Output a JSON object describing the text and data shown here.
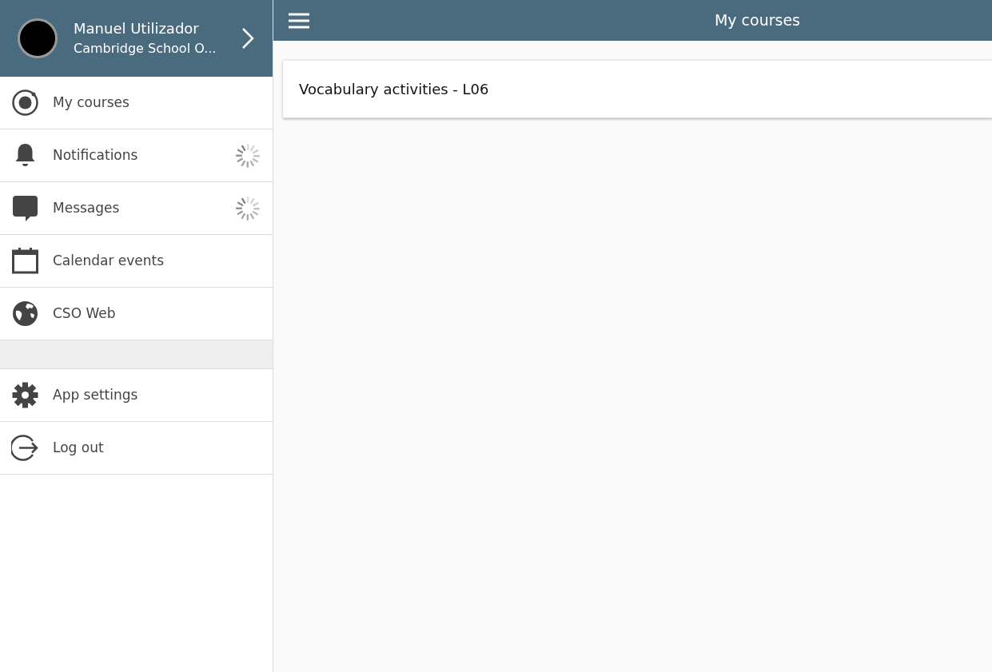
{
  "user": {
    "name": "Manuel Utilizador",
    "site": "Cambridge School O..."
  },
  "menu_groups": [
    [
      {
        "label": "My courses",
        "loading": false
      },
      {
        "label": "Notifications",
        "loading": true
      },
      {
        "label": "Messages",
        "loading": true
      },
      {
        "label": "Calendar events",
        "loading": false
      },
      {
        "label": "CSO Web",
        "loading": false
      }
    ],
    [
      {
        "label": "App settings",
        "loading": false
      },
      {
        "label": "Log out",
        "loading": false
      }
    ]
  ],
  "header": {
    "title": "My courses"
  },
  "courses": [
    {
      "name": "Vocabulary activities - L06"
    }
  ]
}
